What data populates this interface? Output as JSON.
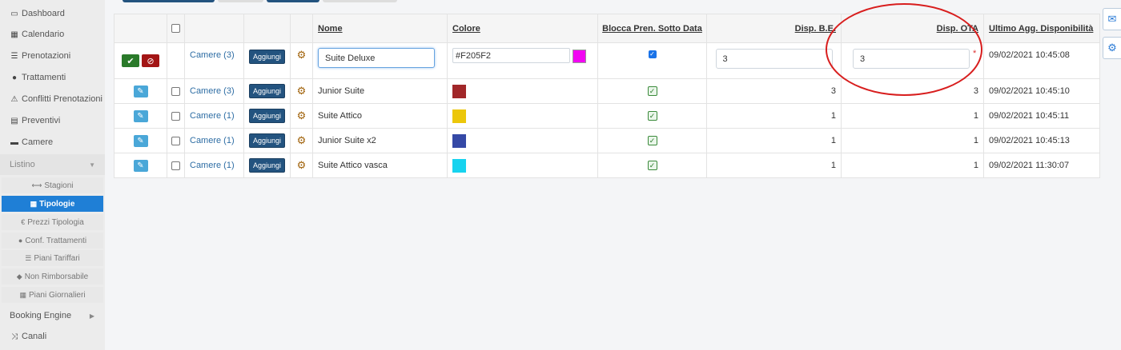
{
  "sidebar": {
    "items": [
      {
        "label": "Dashboard",
        "icon": "dashboard-icon"
      },
      {
        "label": "Calendario",
        "icon": "calendar-icon"
      },
      {
        "label": "Prenotazioni",
        "icon": "list-icon"
      },
      {
        "label": "Trattamenti",
        "icon": "apple-icon"
      },
      {
        "label": "Conflitti Prenotazioni",
        "icon": "warning-icon"
      },
      {
        "label": "Preventivi",
        "icon": "document-icon"
      },
      {
        "label": "Camere",
        "icon": "bed-icon"
      }
    ],
    "listino": {
      "label": "Listino"
    },
    "sub_items": [
      {
        "label": "Stagioni"
      },
      {
        "label": "Tipologie"
      },
      {
        "label": "Prezzi Tipologia"
      },
      {
        "label": "Conf. Trattamenti"
      },
      {
        "label": "Piani Tariffari"
      },
      {
        "label": "Non Rimborsabile"
      },
      {
        "label": "Piani Giornalieri"
      }
    ],
    "booking_engine": {
      "label": "Booking Engine"
    },
    "canali": {
      "label": "Canali"
    }
  },
  "table": {
    "headers": {
      "nome": "Nome",
      "colore": "Colore",
      "blocca": "Blocca Pren. Sotto Data",
      "disp_be": "Disp. B.E.",
      "disp_ota": "Disp. OTA",
      "ultimo_agg": "Ultimo Agg. Disponibilità"
    },
    "edit_row": {
      "camere": "Camere (3)",
      "add_label": "Aggiungi",
      "nome_value": "Suite Deluxe",
      "colore_value": "#F205F2",
      "colore_hex": "#f205f2",
      "disp_be_value": "3",
      "disp_ota_value": "3",
      "required_mark": "*",
      "ultimo_agg": "09/02/2021 10:45:08"
    },
    "rows": [
      {
        "camere": "Camere (3)",
        "add_label": "Aggiungi",
        "nome": "Junior Suite",
        "color": "#a12729",
        "disp_be": "3",
        "disp_ota": "3",
        "ultimo_agg": "09/02/2021 10:45:10"
      },
      {
        "camere": "Camere (1)",
        "add_label": "Aggiungi",
        "nome": "Suite Attico",
        "color": "#ecc70a",
        "disp_be": "1",
        "disp_ota": "1",
        "ultimo_agg": "09/02/2021 10:45:11"
      },
      {
        "camere": "Camere (1)",
        "add_label": "Aggiungi",
        "nome": "Junior Suite x2",
        "color": "#3549a6",
        "disp_be": "1",
        "disp_ota": "1",
        "ultimo_agg": "09/02/2021 10:45:13"
      },
      {
        "camere": "Camere (1)",
        "add_label": "Aggiungi",
        "nome": "Suite Attico vasca",
        "color": "#17d3ef",
        "disp_be": "1",
        "disp_ota": "1",
        "ultimo_agg": "09/02/2021 11:30:07"
      }
    ]
  },
  "colors": {
    "accent": "#1f7fd6",
    "annotation": "#d81e1e",
    "save": "#2a7a2a",
    "cancel": "#a31515"
  }
}
